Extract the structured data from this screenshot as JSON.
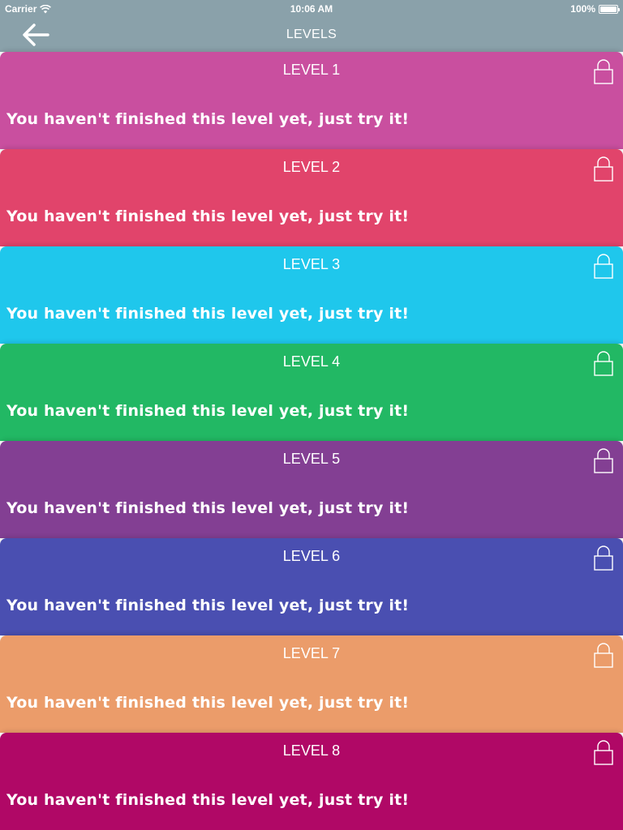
{
  "status_bar": {
    "carrier": "Carrier",
    "time": "10:06 AM",
    "battery": "100%",
    "icons": [
      "wifi-icon",
      "battery-icon"
    ]
  },
  "nav": {
    "back_icon": "arrow-left-icon",
    "title": "LEVELS"
  },
  "levels": [
    {
      "title": "LEVEL 1",
      "message": "You haven't finished this level yet, just try it!",
      "color": "#c94f9f",
      "locked": true
    },
    {
      "title": "LEVEL 2",
      "message": "You haven't finished this level yet, just try it!",
      "color": "#e1446b",
      "locked": true
    },
    {
      "title": "LEVEL 3",
      "message": "You haven't finished this level yet, just try it!",
      "color": "#1fc7ec",
      "locked": true
    },
    {
      "title": "LEVEL 4",
      "message": "You haven't finished this level yet, just try it!",
      "color": "#22b864",
      "locked": true
    },
    {
      "title": "LEVEL 5",
      "message": "You haven't finished this level yet, just try it!",
      "color": "#833f93",
      "locked": true
    },
    {
      "title": "LEVEL 6",
      "message": "You haven't finished this level yet, just try it!",
      "color": "#4a4fb1",
      "locked": true
    },
    {
      "title": "LEVEL 7",
      "message": "You haven't finished this level yet, just try it!",
      "color": "#eb9c6a",
      "locked": true
    },
    {
      "title": "LEVEL 8",
      "message": "You haven't finished this level yet, just try it!",
      "color": "#b00866",
      "locked": true
    }
  ]
}
